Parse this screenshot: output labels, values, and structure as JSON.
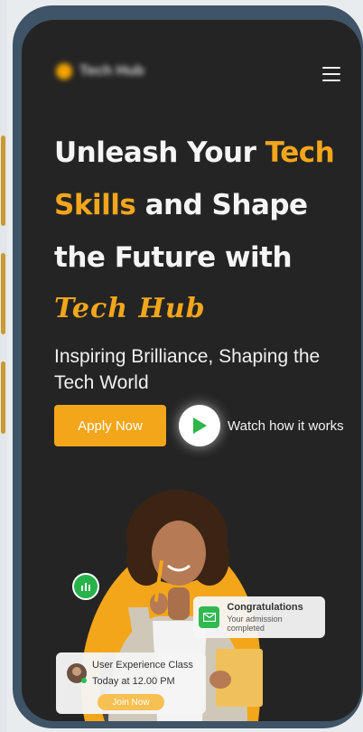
{
  "brand": {
    "name": "Tech Hub",
    "accent": "#f4a61a",
    "background": "#242424",
    "frame": "#3f5466"
  },
  "nav": {
    "menu_icon": "menu-icon"
  },
  "hero": {
    "headline_1": "Unleash Your ",
    "headline_hl_1": "Tech",
    "headline_hl_2": "Skills",
    "headline_2": " and Shape",
    "headline_3": "the Future with",
    "script_brand": "Tech Hub",
    "subtitle": "Inspiring Brilliance, Shaping the Tech World",
    "apply_label": "Apply Now",
    "watch_label": "Watch how it works"
  },
  "cards": {
    "congrats_title": "Congratulations",
    "congrats_sub": "Your admission completed",
    "class_title": "User Experience Class",
    "class_time": "Today at 12.00 PM",
    "join_label": "Join Now"
  },
  "icons": {
    "play": "play-icon",
    "stats": "bar-chart-icon",
    "mail": "mail-icon"
  }
}
